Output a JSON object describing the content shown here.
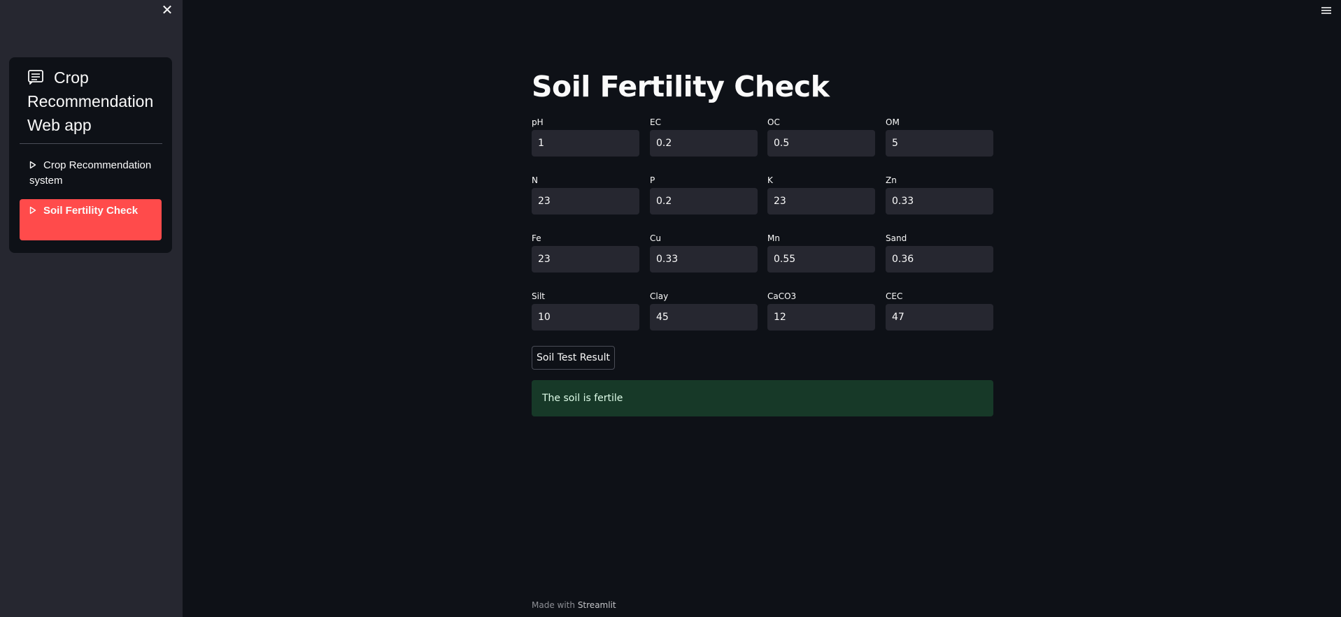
{
  "sidebar": {
    "close_glyph": "✕",
    "menu": {
      "title": "Crop Recommendation Web app",
      "title_icon": "document-list-icon",
      "items": [
        {
          "label": "Crop Recommendation system",
          "icon": "play-outline-icon"
        },
        {
          "label": "Soil Fertility Check",
          "icon": "play-outline-icon",
          "active": true
        }
      ]
    }
  },
  "main": {
    "title": "Soil Fertility Check",
    "fields": [
      {
        "label": "pH",
        "value": "1"
      },
      {
        "label": "EC",
        "value": "0.2"
      },
      {
        "label": "OC",
        "value": "0.5"
      },
      {
        "label": "OM",
        "value": "5"
      },
      {
        "label": "N",
        "value": "23"
      },
      {
        "label": "P",
        "value": "0.2"
      },
      {
        "label": "K",
        "value": "23"
      },
      {
        "label": "Zn",
        "value": "0.33"
      },
      {
        "label": "Fe",
        "value": "23"
      },
      {
        "label": "Cu",
        "value": "0.33"
      },
      {
        "label": "Mn",
        "value": "0.55"
      },
      {
        "label": "Sand",
        "value": "0.36"
      },
      {
        "label": "Silt",
        "value": "10"
      },
      {
        "label": "Clay",
        "value": "45"
      },
      {
        "label": "CaCO3",
        "value": "12"
      },
      {
        "label": "CEC",
        "value": "47"
      }
    ],
    "submit_label": "Soil Test Result",
    "result": "The soil is fertile"
  },
  "footer": {
    "prefix": "Made with",
    "brand": "Streamlit"
  },
  "colors": {
    "background": "#0e1117",
    "sidebar": "#262730",
    "accent": "#ff4b4b",
    "success_bg": "#173928",
    "input_bg": "#262730"
  }
}
